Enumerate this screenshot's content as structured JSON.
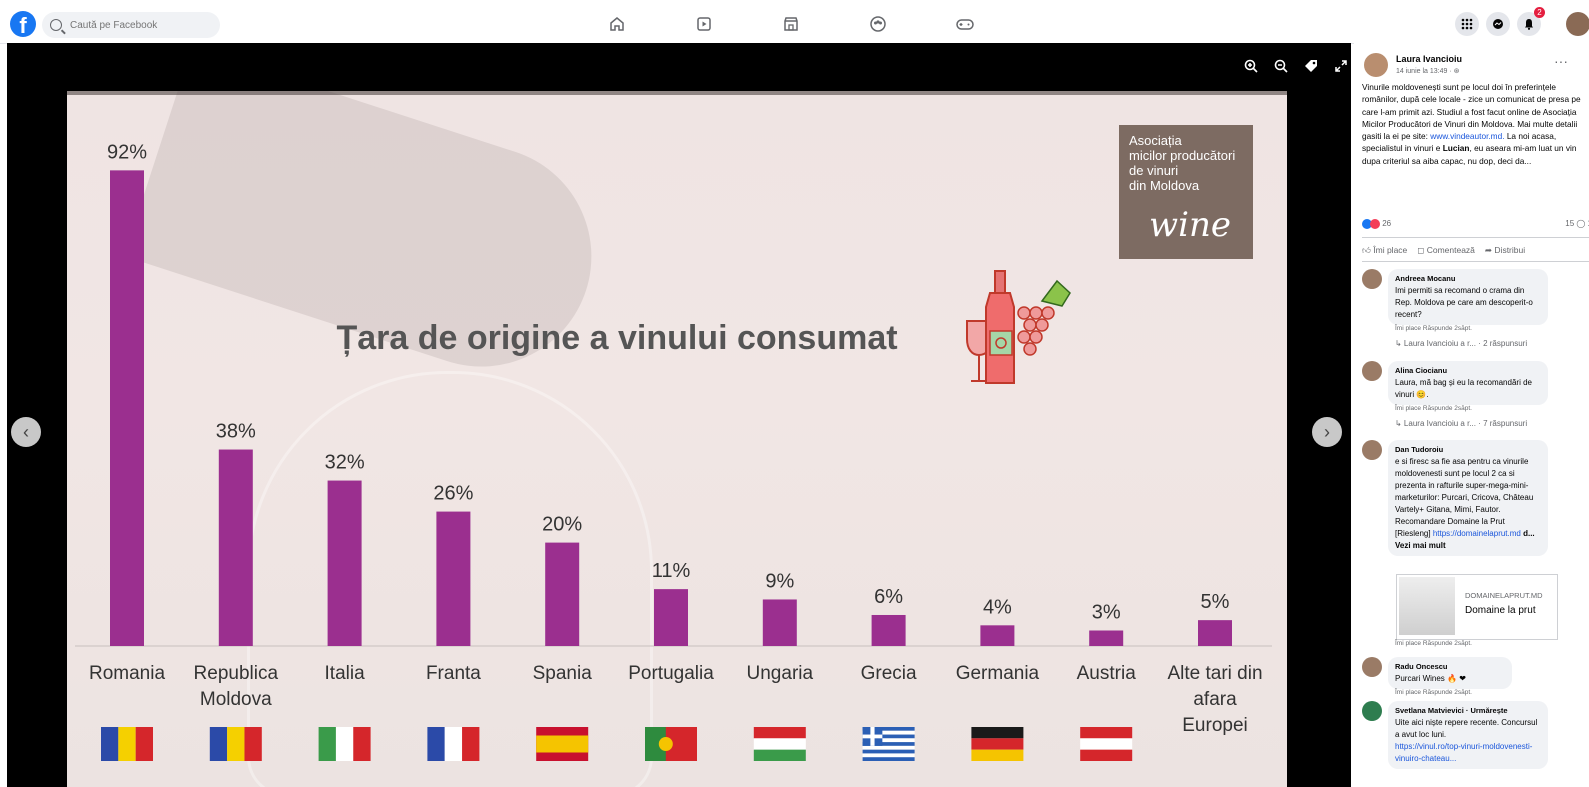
{
  "topbar": {
    "search_placeholder": "Caută pe Facebook",
    "nav": [
      "home-icon",
      "watch-icon",
      "marketplace-icon",
      "groups-icon",
      "gaming-icon"
    ],
    "notifications_badge": "2"
  },
  "slide": {
    "title": "Țara de origine a vinului consumat",
    "assoc_text": "Asociația\nmicilor producători\nde vinuri\ndin Moldova",
    "assoc_script": "wine"
  },
  "chart_data": {
    "type": "bar",
    "title": "Țara de origine a vinului consumat",
    "categories": [
      "Romania",
      "Republica Moldova",
      "Italia",
      "Franta",
      "Spania",
      "Portugalia",
      "Ungaria",
      "Grecia",
      "Germania",
      "Austria",
      "Alte tari din afara Europei"
    ],
    "category_lines": [
      [
        "Romania"
      ],
      [
        "Republica",
        "Moldova"
      ],
      [
        "Italia"
      ],
      [
        "Franta"
      ],
      [
        "Spania"
      ],
      [
        "Portugalia"
      ],
      [
        "Ungaria"
      ],
      [
        "Grecia"
      ],
      [
        "Germania"
      ],
      [
        "Austria"
      ],
      [
        "Alte tari din",
        "afara",
        "Europei"
      ]
    ],
    "values": [
      92,
      38,
      32,
      26,
      20,
      11,
      9,
      6,
      4,
      3,
      5
    ],
    "value_labels": [
      "92%",
      "38%",
      "32%",
      "26%",
      "20%",
      "11%",
      "9%",
      "6%",
      "4%",
      "3%",
      "5%"
    ],
    "bar_color": "#9b2f8f",
    "ylim": [
      0,
      100
    ]
  },
  "post": {
    "author": "Laura Ivancioiu",
    "date": "14 iunie la 13:49 · ⊛",
    "text": "Vinurile moldovenești sunt pe locul doi în preferințele românilor, după cele locale - zice un comunicat de presa pe care l-am primit azi. Studiul a fost facut online de Asociația Micilor Producători de Vinuri din Moldova. Mai multe detalii gasiti la ei pe site: ",
    "link": "www.vindeautor.md.",
    "text2": " La noi acasa, specialistul in vinuri e ",
    "bold_name": "Lucian",
    "text3": ", eu aseara mi-am luat un vin dupa criteriul sa aiba capac, nu dop, deci da...",
    "reaction_count": "26",
    "comments_count": "15 ◯ 1",
    "like_label": "Îmi place",
    "comment_label": "Comentează",
    "share_label": "Distribui"
  },
  "comments": [
    {
      "name": "Andreea Mocanu",
      "text": "Imi permiti sa recomand o crama din Rep. Moldova pe care am descoperit-o recent?",
      "meta": "Îmi place   Răspunde   2săpt.",
      "reply": "↳ Laura Ivancioiu a r... · 2 răspunsuri"
    },
    {
      "name": "Alina Ciocianu",
      "text": "Laura, mă bag și eu la recomandări de vinuri 😊.",
      "meta": "Îmi place   Răspunde   2săpt.",
      "reply": "↳ Laura Ivancioiu a r... · 7 răspunsuri"
    },
    {
      "name": "Dan Tudoroiu",
      "text": "e si firesc sa fie asa pentru ca vinurile moldovenesti sunt pe locul 2 ca si prezenta in rafturile super-mega-mini-marketurilor: Purcari, Cricova, Château Vartely+ Gitana, Mimi, Fautor. Recomandare Domaine la Prut [Riesleng]",
      "link": "https://domainelaprut.md",
      "link_suffix": " d... Vezi mai mult",
      "card_domain": "DOMAINELAPRUT.MD",
      "card_title": "Domaine la prut",
      "meta": "Îmi place   Răspunde   2săpt."
    },
    {
      "name": "Radu Oncescu",
      "text": "Purcari Wines 🔥 ❤",
      "meta": "Îmi place   Răspunde   2săpt."
    },
    {
      "name": "Svetlana Matvievici · Urmărește",
      "text": "Uite aici niște repere recente. Concursul a avut loc luni.",
      "link": "https://vinul.ro/top-vinuri-moldovenesti-vinuiro-chateau..."
    }
  ]
}
